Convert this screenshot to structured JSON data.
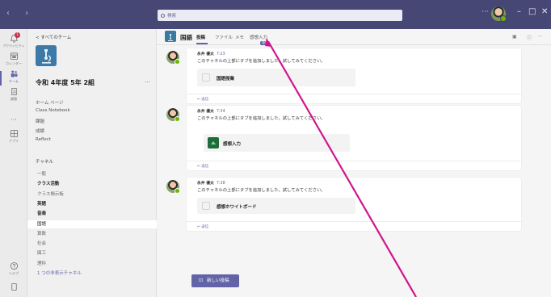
{
  "titlebar": {
    "nav": "‹ ›",
    "search_placeholder": "検索",
    "more": "···",
    "minimize": "–",
    "maximize": "□",
    "close": "✕"
  },
  "rail": [
    {
      "name": "activity",
      "label": "アクティビティ",
      "badge": "1"
    },
    {
      "name": "calendar",
      "label": "カレンダー"
    },
    {
      "name": "teams",
      "label": "チーム"
    },
    {
      "name": "assignments",
      "label": "課題"
    },
    {
      "name": "more",
      "label": ""
    },
    {
      "name": "apps",
      "label": "アプリ"
    },
    {
      "name": "help",
      "label": "ヘルプ"
    }
  ],
  "leftpane": {
    "back": "< すべてのチーム",
    "team_name": "令和 4年度 5年 2組",
    "team_more": "···",
    "items": [
      "ホーム ページ",
      "Class Notebook",
      "課題",
      "成績",
      "Reflect"
    ],
    "section": "チャネル",
    "channels": [
      {
        "label": "一般",
        "bold": false,
        "selected": false,
        "link": false
      },
      {
        "label": "クラス活動",
        "bold": true,
        "selected": false,
        "link": false
      },
      {
        "label": "クラス掲示板",
        "bold": false,
        "selected": false,
        "link": false
      },
      {
        "label": "英語",
        "bold": true,
        "selected": false,
        "link": false
      },
      {
        "label": "音楽",
        "bold": true,
        "selected": false,
        "link": false
      },
      {
        "label": "国語",
        "bold": false,
        "selected": true,
        "link": false
      },
      {
        "label": "算数",
        "bold": false,
        "selected": false,
        "link": false
      },
      {
        "label": "社会",
        "bold": false,
        "selected": false,
        "link": false
      },
      {
        "label": "図工",
        "bold": false,
        "selected": false,
        "link": false
      },
      {
        "label": "理科",
        "bold": false,
        "selected": false,
        "link": false
      },
      {
        "label": "1 つの非表示チャネル",
        "bold": false,
        "selected": false,
        "link": true
      }
    ]
  },
  "main": {
    "channel_title": "国語",
    "tabs": [
      "投稿",
      "ファイル",
      "メモ",
      "感想入力"
    ],
    "new_badge": "新規",
    "posts": [
      {
        "author": "永井 優太",
        "time": "7:23",
        "message": "このチャネルの上部にタブを追加しました。試してみてください。",
        "card": "国語授業",
        "reply": "返信"
      },
      {
        "author": "永井 優太",
        "time": "7:34",
        "message": "このチャネルの上部にタブを追加しました。試してみてください。",
        "card": "感想入力",
        "reply": "返信"
      },
      {
        "author": "永井 優太",
        "time": "7:38",
        "message": "このチャネルの上部にタブを追加しました。試してみてください。",
        "card": "感想ホワイトボード",
        "reply": "返信"
      }
    ],
    "new_post": "新しい投稿"
  },
  "colors": {
    "titlebar": "#464775",
    "accent": "#6264a7",
    "annotation": "#d0168c"
  }
}
